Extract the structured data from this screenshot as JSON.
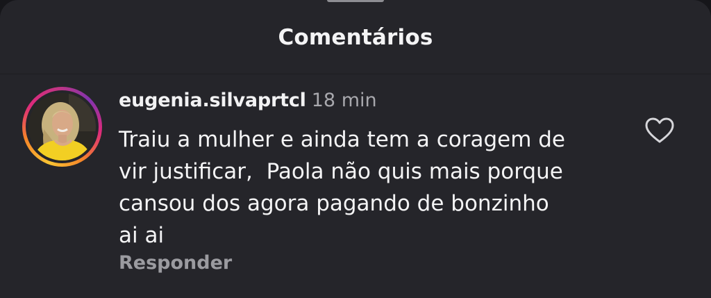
{
  "sheet": {
    "title": "Comentários"
  },
  "comment": {
    "username": "eugenia.silvaprtcl",
    "time": "18 min",
    "text": "Traiu a mulher e ainda tem a coragem de\nvir justificar,  Paola não quis mais porque\ncansou dos agora pagando de bonzinho\nai ai",
    "reply_label": "Responder",
    "like_icon": "heart-outline-icon",
    "avatar_ring_colors": [
      "#f9c433",
      "#f58529",
      "#dd2a7b",
      "#c13584",
      "#8134af"
    ]
  },
  "theme": {
    "background": "#25252a",
    "text_primary": "#f4f4f5",
    "text_secondary": "#a8a8ad"
  }
}
